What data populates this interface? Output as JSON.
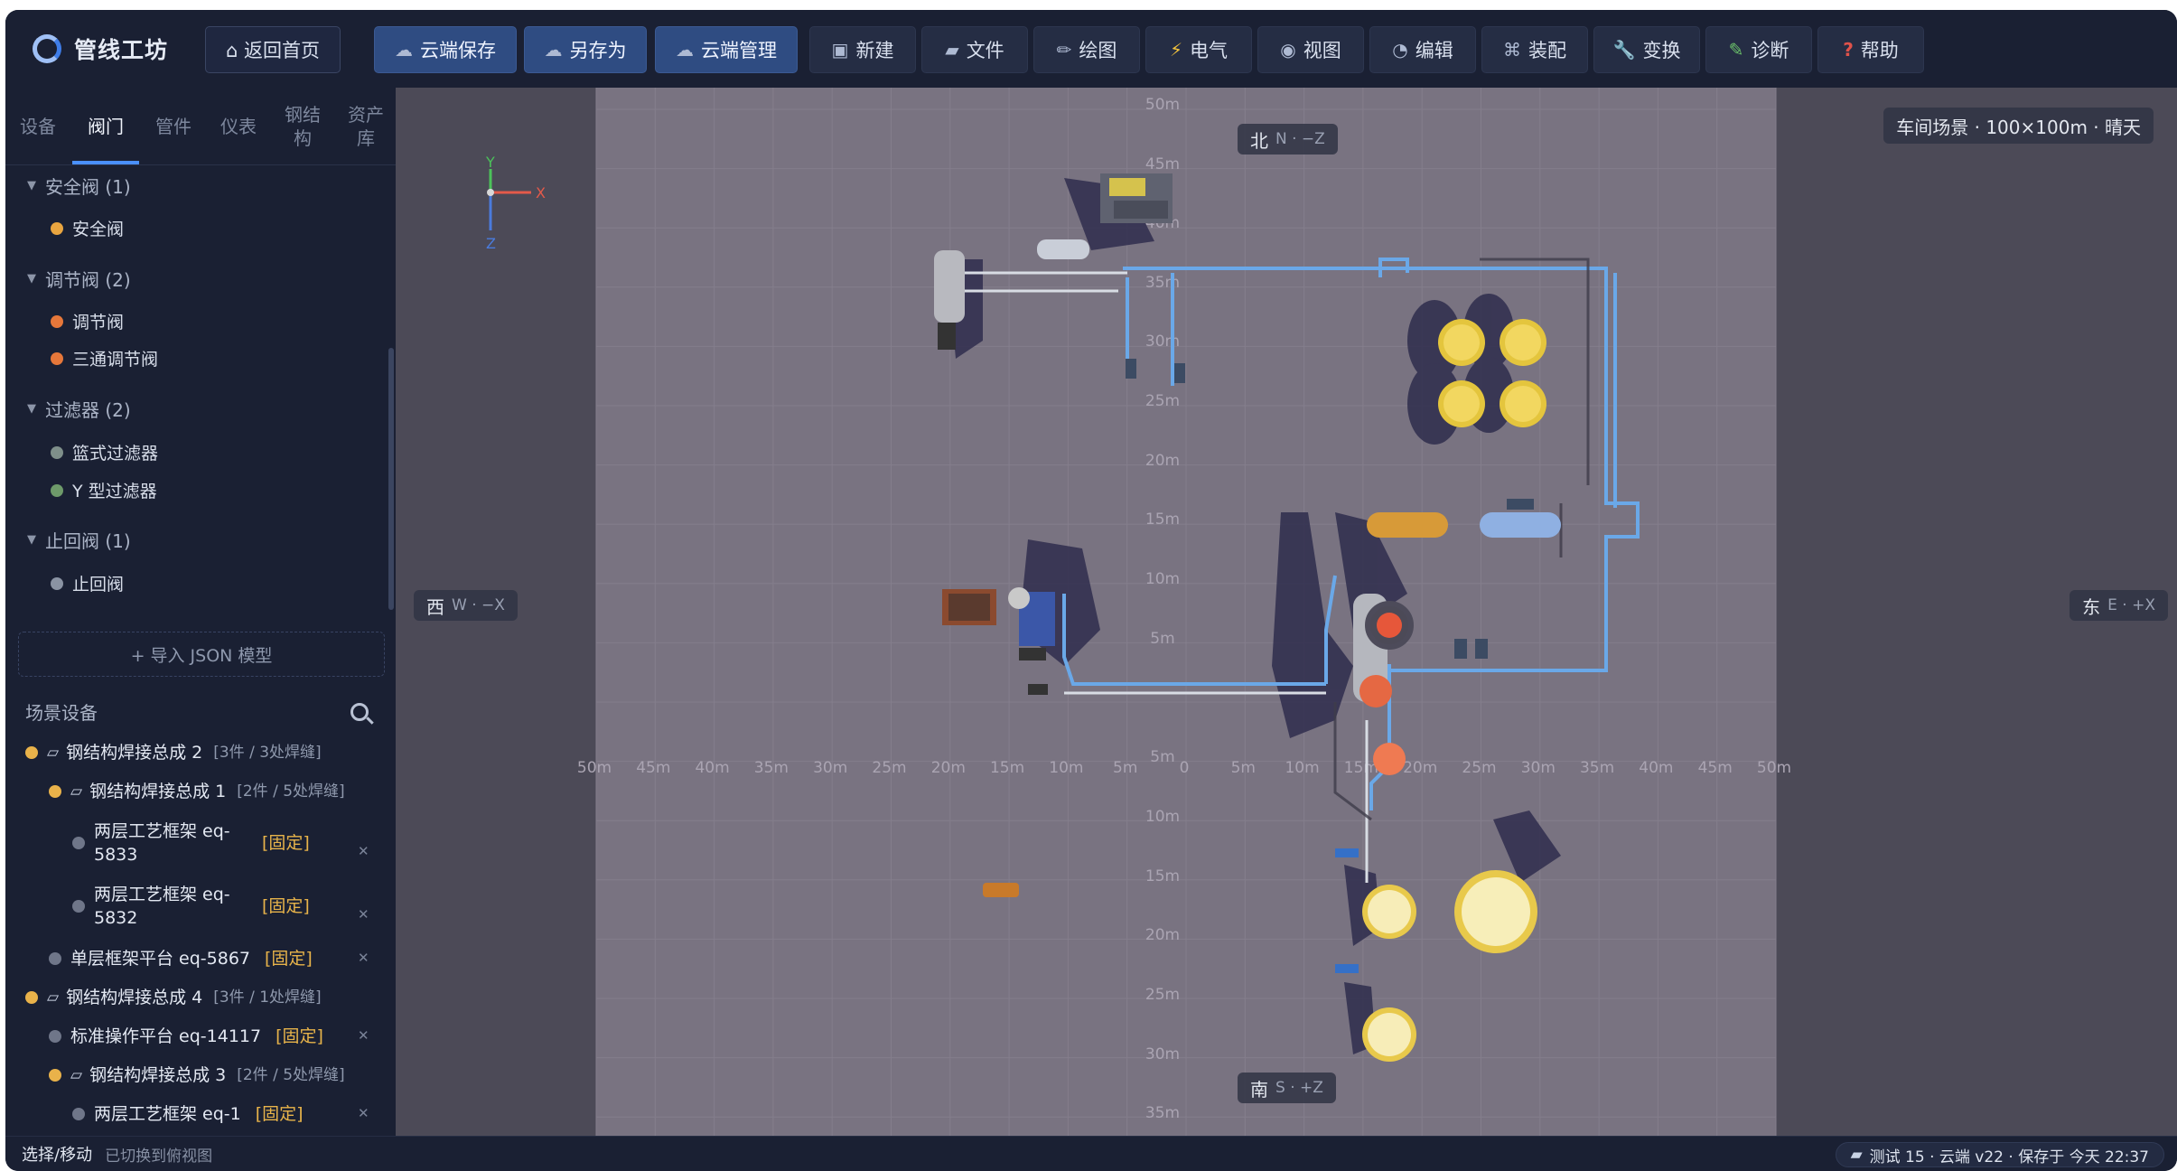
{
  "app": {
    "title": "管线工坊"
  },
  "toolbar": {
    "home": "⌂ 返回首页",
    "cloud_save": "云端保存",
    "save_as": "另存为",
    "cloud_manage": "云端管理",
    "new": "新建",
    "file": "文件",
    "draw": "绘图",
    "electric": "电气",
    "view": "视图",
    "edit": "编辑",
    "assemble": "装配",
    "transform": "变换",
    "diagnose": "诊断",
    "help": "帮助"
  },
  "category_tabs": [
    "设备",
    "阀门",
    "管件",
    "仪表",
    "钢结构",
    "资产库"
  ],
  "active_tab": "阀门",
  "valve_tree": [
    {
      "group": "安全阀 (1)",
      "items": [
        {
          "label": "安全阀",
          "color": "#e9a540"
        }
      ]
    },
    {
      "group": "调节阀 (2)",
      "items": [
        {
          "label": "调节阀",
          "color": "#e6773a"
        },
        {
          "label": "三通调节阀",
          "color": "#e6773a"
        }
      ]
    },
    {
      "group": "过滤器 (2)",
      "items": [
        {
          "label": "篮式过滤器",
          "color": "#7e8f8a"
        },
        {
          "label": "Y 型过滤器",
          "color": "#6e9a6a"
        }
      ]
    },
    {
      "group": "止回阀 (1)",
      "items": [
        {
          "label": "止回阀",
          "color": "#8a93a3"
        }
      ]
    }
  ],
  "import_button": "+ 导入 JSON 模型",
  "scene": {
    "title": "场景设备",
    "rows": [
      {
        "name": "钢结构焊接总成 2",
        "meta": "[3件 / 3处焊缝]",
        "assembly": true
      },
      {
        "name": "钢结构焊接总成 1",
        "meta": "[2件 / 5处焊缝]",
        "assembly": true
      },
      {
        "name": "两层工艺框架 eq-5833",
        "fixed": "[固定]",
        "closable": true
      },
      {
        "name": "两层工艺框架 eq-5832",
        "fixed": "[固定]",
        "closable": true
      },
      {
        "name": "单层框架平台 eq-5867",
        "fixed": "[固定]",
        "closable": true
      },
      {
        "name": "钢结构焊接总成 4",
        "meta": "[3件 / 1处焊缝]",
        "assembly": true
      },
      {
        "name": "标准操作平台 eq-14117",
        "fixed": "[固定]",
        "closable": true
      },
      {
        "name": "钢结构焊接总成 3",
        "meta": "[2件 / 5处焊缝]",
        "assembly": true
      },
      {
        "name": "两层工艺框架 eq-1",
        "fixed": "[固定]",
        "closable": true
      }
    ]
  },
  "viewport": {
    "scene_info": "车间场景 · 100×100m · 晴天",
    "compass": {
      "north": "北",
      "north_sub": "N · −Z",
      "south": "南",
      "south_sub": "S · +Z",
      "west": "西",
      "west_sub": "W · −X",
      "east": "东",
      "east_sub": "E · +X"
    },
    "axes": {
      "x": "X",
      "y": "Y",
      "z": "Z"
    },
    "x_ticks": [
      "50m",
      "45m",
      "40m",
      "35m",
      "30m",
      "25m",
      "20m",
      "15m",
      "10m",
      "5m",
      "0",
      "5m",
      "10m",
      "15m",
      "20m",
      "25m",
      "30m",
      "35m",
      "40m",
      "45m",
      "50m"
    ],
    "z_ticks": [
      "50m",
      "45m",
      "40m",
      "35m",
      "30m",
      "25m",
      "20m",
      "15m",
      "10m",
      "5m",
      "5m",
      "10m",
      "15m",
      "20m",
      "25m",
      "30m",
      "35m"
    ]
  },
  "status": {
    "mode": "选择/移动",
    "message": "已切换到俯视图",
    "info": "测试 15 · 云端 v22 · 保存于 今天 22:37"
  },
  "colors": {
    "app_bg": "#161c2c",
    "panel_bg": "#1a2033",
    "accent": "#4a90ff",
    "viewport_bg": "#4c4a57",
    "floor": "#797381",
    "pipe": "#6aa8e8",
    "fixed_tag": "#e7b34a"
  }
}
